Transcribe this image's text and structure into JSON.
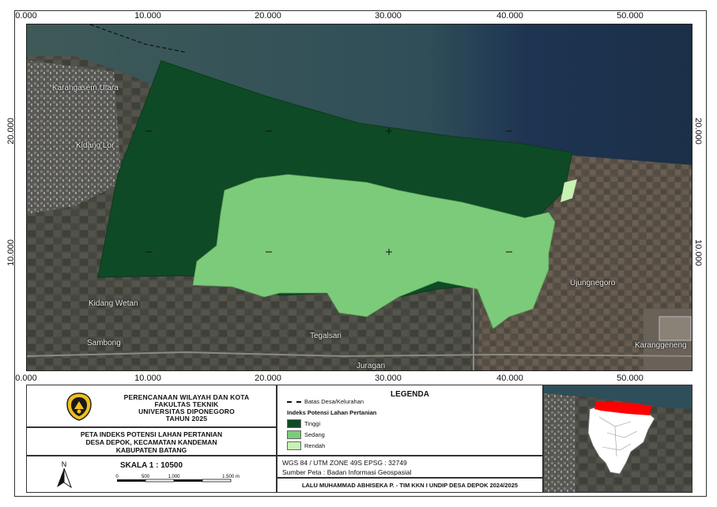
{
  "grid": {
    "x_labels": [
      "0.000",
      "10.000",
      "20.000",
      "30.000",
      "40.000",
      "50.000"
    ],
    "y_labels": [
      "20.000",
      "10.000"
    ]
  },
  "places": [
    "Karangasem Utara",
    "Kidang Lor",
    "Kidang Wetan",
    "Sambong",
    "Tegalsari",
    "Juragan",
    "Ujungnegoro",
    "Karanggeneng"
  ],
  "title_block": {
    "lines": [
      "PERENCANAAN WILAYAH DAN KOTA",
      "FAKULTAS TEKNIK",
      "UNIVERSITAS DIPONEGORO",
      "TAHUN 2025"
    ]
  },
  "map_name": {
    "lines": [
      "PETA INDEKS POTENSI LAHAN PERTANIAN",
      "DESA DEPOK, KECAMATAN KANDEMAN",
      "KABUPATEN BATANG"
    ]
  },
  "scale": {
    "label": "SKALA 1 : 10500",
    "ticks": [
      "0",
      "500",
      "1.000",
      "1.500 m"
    ]
  },
  "north_arrow": {
    "label": "N",
    "icon": "north-arrow-icon"
  },
  "legend": {
    "title": "LEGENDA",
    "boundary_label": "Batas Desa/Kelurahan",
    "index_title": "Indeks Potensi Lahan Pertanian",
    "classes": [
      {
        "label": "Tinggi",
        "color": "#0f4a26"
      },
      {
        "label": "Sedang",
        "color": "#7ccb7a"
      },
      {
        "label": "Rendah",
        "color": "#c6f2b4"
      }
    ]
  },
  "info": {
    "crs": "WGS 84 / UTM ZONE 49S EPSG : 32749",
    "source": "Sumber Peta : Badan Informasi Geospasial"
  },
  "author": "LALU MUHAMMAD ABHISEKA P. - TIM KKN I UNDIP DESA DEPOK 2024/2025",
  "colors": {
    "sea": "#2e4e5a",
    "land": "#4a4a44",
    "highlight": "#ff0000"
  }
}
